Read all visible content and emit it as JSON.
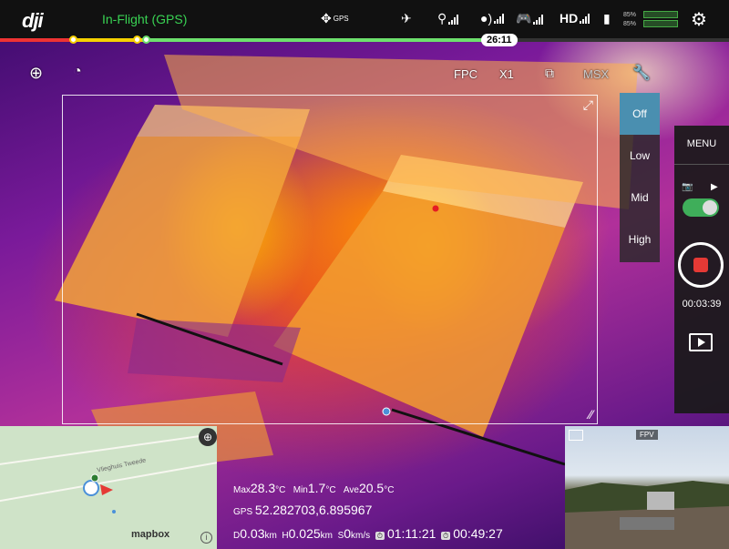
{
  "topbar": {
    "logo": "dji",
    "flight_status": "In-Flight (GPS)",
    "gps_label": "GPS",
    "hd_label": "HD",
    "battery_pct_top": "85%",
    "battery_pct_bottom": "85%",
    "battery_cell_1": "",
    "battery_cell_2": "",
    "flight_time_remaining": "26:11",
    "colors": {
      "status": "#39d353",
      "accent_red": "#e33333",
      "accent_yellow": "#f5d100",
      "accent_green": "#6de06d"
    }
  },
  "camera_bar": {
    "fpv_label": "FPC",
    "zoom_label": "X1",
    "msx_label": "MSX"
  },
  "gain_menu": {
    "options": [
      "Off",
      "Low",
      "Mid",
      "High"
    ],
    "selected": "Off"
  },
  "side_panel": {
    "menu_label": "MENU",
    "record_time": "00:03:39"
  },
  "map": {
    "street_label": "Vlieghuis Tweede",
    "brand": "mapbox",
    "info": "i"
  },
  "readout": {
    "max_label": "Max",
    "max_value": "28.3",
    "max_unit": "°C",
    "min_label": "Min",
    "min_value": "1.7",
    "min_unit": "°C",
    "ave_label": "Ave",
    "ave_value": "20.5",
    "ave_unit": "°C",
    "gps_label": "GPS",
    "gps_value": "52.282703,6.895967",
    "d_label": "D",
    "d_value": "0.03",
    "d_unit": "km",
    "h_label": "H",
    "h_value": "0.025",
    "h_unit": "km",
    "s_label": "S",
    "s_value": "0",
    "s_unit": "km/s",
    "time1": "01:11:21",
    "time2": "00:49:27"
  },
  "fpv": {
    "label": "FPV"
  }
}
